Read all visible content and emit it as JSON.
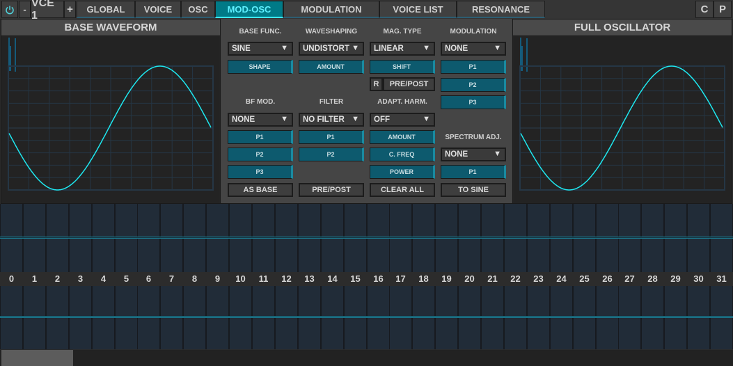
{
  "topbar": {
    "power_icon": "power-icon",
    "decrement_label": "-",
    "voice_label": "VCE 1",
    "increment_label": "+",
    "tabs": [
      {
        "label": "GLOBAL",
        "active": false
      },
      {
        "label": "VOICE",
        "active": false
      },
      {
        "label": "OSC",
        "active": false
      },
      {
        "label": "MOD-OSC",
        "active": true
      },
      {
        "label": "MODULATION",
        "active": false
      },
      {
        "label": "VOICE LIST",
        "active": false
      },
      {
        "label": "RESONANCE",
        "active": false
      }
    ],
    "c_label": "C",
    "p_label": "P"
  },
  "base_waveform": {
    "title": "BASE WAVEFORM",
    "waveform": "sine",
    "phase_start_value": -0.08,
    "cycles_visible": 1
  },
  "full_oscillator": {
    "title": "FULL OSCILLATOR",
    "waveform": "sine"
  },
  "modosc": {
    "base_func": {
      "label": "BASE FUNC.",
      "value": "SINE",
      "knob": "SHAPE"
    },
    "waveshaping": {
      "label": "WAVESHAPING",
      "value": "UNDISTORT",
      "knob": "AMOUNT"
    },
    "mag_type": {
      "label": "MAG. TYPE",
      "value": "LINEAR",
      "knob": "SHIFT",
      "r_label": "R",
      "prepost_label": "PRE/POST"
    },
    "modulation": {
      "label": "MODULATION",
      "value": "NONE",
      "knobs": [
        "P1",
        "P2",
        "P3"
      ]
    },
    "bf_mod": {
      "label": "BF MOD.",
      "value": "NONE",
      "knobs": [
        "P1",
        "P2",
        "P3"
      ],
      "button": "AS BASE"
    },
    "filter": {
      "label": "FILTER",
      "value": "NO FILTER",
      "knobs": [
        "P1",
        "P2"
      ],
      "button": "PRE/POST"
    },
    "adapt_harm": {
      "label": "ADAPT. HARM.",
      "value": "OFF",
      "knobs": [
        "AMOUNT",
        "C. FREQ",
        "POWER"
      ],
      "button": "CLEAR ALL"
    },
    "spectrum_adj": {
      "label": "SPECTRUM ADJ.",
      "value": "NONE",
      "knobs": [
        "P1"
      ],
      "button": "TO SINE"
    },
    "dropdown_arrow": "▼"
  },
  "harmonics": {
    "numbers": [
      "0",
      "1",
      "2",
      "3",
      "4",
      "5",
      "6",
      "7",
      "8",
      "9",
      "10",
      "11",
      "12",
      "13",
      "14",
      "15",
      "16",
      "17",
      "18",
      "19",
      "20",
      "21",
      "22",
      "23",
      "24",
      "25",
      "26",
      "27",
      "28",
      "29",
      "30",
      "31"
    ],
    "magnitudes": [
      0,
      0,
      0,
      0,
      0,
      0,
      0,
      0,
      0,
      0,
      0,
      0,
      0,
      0,
      0,
      0,
      0,
      0,
      0,
      0,
      0,
      0,
      0,
      0,
      0,
      0,
      0,
      0,
      0,
      0,
      0,
      0
    ],
    "phases": [
      0,
      0,
      0,
      0,
      0,
      0,
      0,
      0,
      0,
      0,
      0,
      0,
      0,
      0,
      0,
      0,
      0,
      0,
      0,
      0,
      0,
      0,
      0,
      0,
      0,
      0,
      0,
      0,
      0,
      0,
      0,
      0
    ]
  },
  "colors": {
    "accent": "#007a87",
    "accent_text": "#5ff0ff",
    "wave": "#1ee8f0",
    "knob": "#0d5a6e"
  }
}
